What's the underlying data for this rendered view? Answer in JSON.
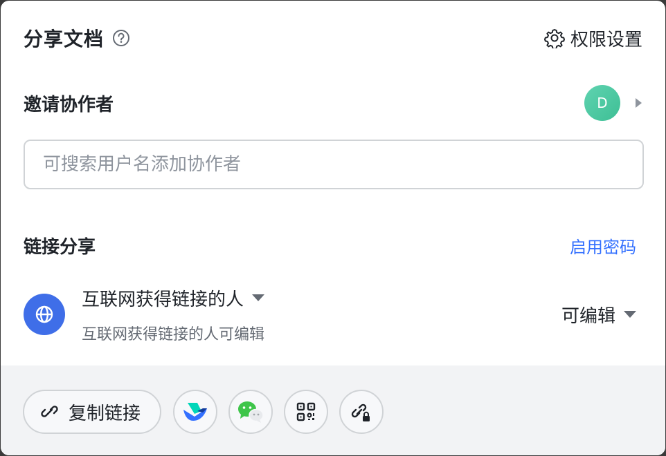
{
  "header": {
    "title": "分享文档",
    "permission_settings_label": "权限设置"
  },
  "invite": {
    "label": "邀请协作者",
    "avatar_initial": "D",
    "search_placeholder": "可搜索用户名添加协作者"
  },
  "link_share": {
    "label": "链接分享",
    "enable_password": "启用密码",
    "scope": "互联网获得链接的人",
    "scope_desc": "互联网获得链接的人可编辑",
    "permission": "可编辑"
  },
  "footer": {
    "copy_link_label": "复制链接",
    "buttons": [
      "lark-share-icon",
      "wechat-icon",
      "qrcode-icon",
      "link-lock-icon"
    ]
  },
  "colors": {
    "accent": "#3370ff",
    "globe_bg": "#3f6ee8",
    "avatar_bg": "#4cc7a0"
  }
}
